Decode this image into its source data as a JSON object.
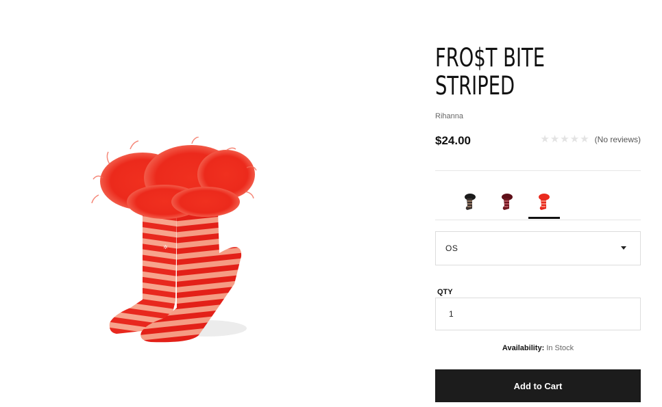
{
  "product": {
    "title_line1": "FRO$T BITE",
    "title_line2": "STRIPED",
    "brand": "Rihanna",
    "price": "$24.00",
    "rating": {
      "stars_filled": 0,
      "stars_total": 5,
      "reviews_text": "(No reviews)"
    },
    "image_icon": "red-striped-fur-cuff-socks",
    "swatches": [
      {
        "name": "black",
        "icon": "black-sock-swatch",
        "active": false
      },
      {
        "name": "burgundy",
        "icon": "burgundy-sock-swatch",
        "active": false
      },
      {
        "name": "red",
        "icon": "red-sock-swatch",
        "active": true
      }
    ],
    "size_select": {
      "value": "OS"
    },
    "qty": {
      "label": "QTY",
      "value": "1"
    },
    "availability": {
      "label": "Availability:",
      "value": "In Stock"
    },
    "add_to_cart_label": "Add to Cart"
  },
  "colors": {
    "sock_red": "#e8281e",
    "sock_stripe_light": "#f6a08a",
    "button_bg": "#1c1c1c"
  }
}
